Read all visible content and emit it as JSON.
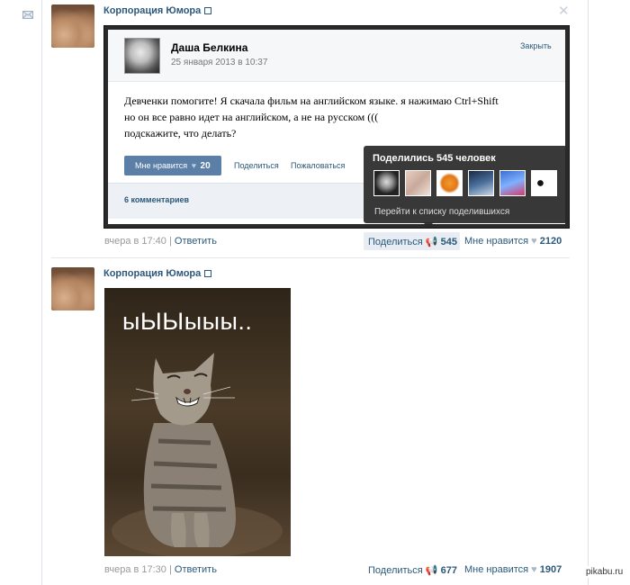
{
  "posts": [
    {
      "author": "Корпорация Юмора",
      "time": "вчера в 17:40",
      "reply": "Ответить",
      "share_label": "Поделиться",
      "share_count": "545",
      "like_label": "Мне нравится",
      "like_count": "2120",
      "embedded": {
        "name": "Даша Белкина",
        "date": "25 января 2013 в 10:37",
        "close": "Закрыть",
        "text": "Девченки помогите! Я скачала фильм на английском языке. я нажимаю Ctrl+Shift\nно он все равно идет на английском, а не на русском (((\nподскажите, что делать?",
        "like_button": "Мне нравится",
        "like_count": "20",
        "share": "Поделиться",
        "report": "Пожаловаться",
        "comments": "6 комментариев"
      },
      "tooltip": {
        "title": "Поделились 545 человек",
        "link": "Перейти к списку поделившихся"
      }
    },
    {
      "author": "Корпорация Юмора",
      "image_text": "ыЫЫыыы..",
      "time": "вчера в 17:30",
      "reply": "Ответить",
      "share_label": "Поделиться",
      "share_count": "677",
      "like_label": "Мне нравится",
      "like_count": "1907"
    }
  ],
  "watermark": "pikabu.ru",
  "colors": {
    "link": "#2b587a",
    "like_button": "#5b7fa6",
    "muted": "#999999"
  }
}
